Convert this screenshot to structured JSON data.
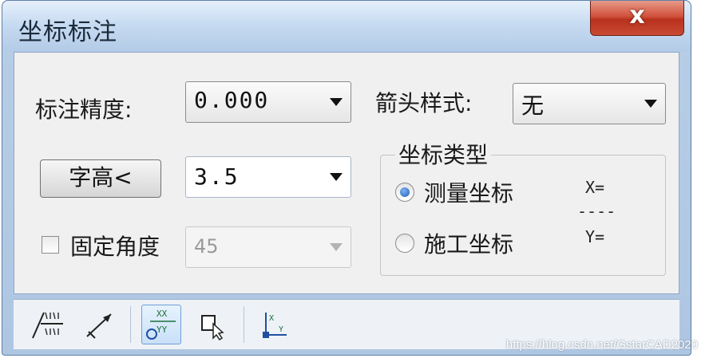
{
  "window": {
    "title": "坐标标注",
    "close_glyph": "x"
  },
  "precision": {
    "label": "标注精度:",
    "value": "0.000"
  },
  "arrow_style": {
    "label": "箭头样式:",
    "value": "无"
  },
  "text_height": {
    "button_label": "字高<",
    "value": "3.5"
  },
  "fixed_angle": {
    "label": "固定角度",
    "value": "45",
    "checked": false
  },
  "coord_type": {
    "title": "坐标类型",
    "options": [
      {
        "label": "测量坐标",
        "selected": true
      },
      {
        "label": "施工坐标",
        "selected": false
      }
    ],
    "formula": {
      "top": "X=",
      "divider": "----",
      "bottom": "Y="
    }
  },
  "toolbar": {
    "items": [
      {
        "icon": "text-above-below-icon",
        "active": false
      },
      {
        "icon": "leader-arrow-icon",
        "active": false
      },
      {
        "icon": "coordinate-xy-icon",
        "active": true
      },
      {
        "icon": "select-pick-icon",
        "active": false
      },
      {
        "icon": "axis-origin-icon",
        "active": false
      }
    ]
  },
  "watermark": "https://blog.csdn.net/GstarCAD2020"
}
